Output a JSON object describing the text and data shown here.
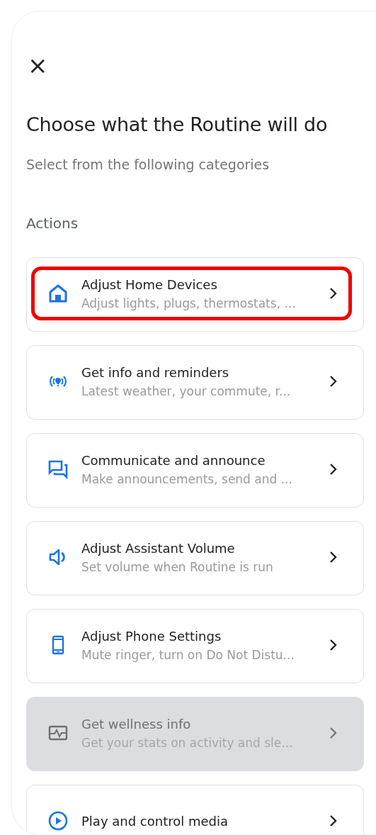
{
  "close_button": "×",
  "title": "Choose what the Routine will do",
  "subtitle": "Select from the following categories",
  "section_label": "Actions",
  "actions": [
    {
      "title": "Adjust Home Devices",
      "description": "Adjust lights, plugs, thermostats, ...",
      "highlighted": true,
      "disabled": false
    },
    {
      "title": "Get info and reminders",
      "description": "Latest weather, your commute, r...",
      "highlighted": false,
      "disabled": false
    },
    {
      "title": "Communicate and announce",
      "description": "Make announcements, send and ...",
      "highlighted": false,
      "disabled": false
    },
    {
      "title": "Adjust Assistant Volume",
      "description": "Set volume when Routine is run",
      "highlighted": false,
      "disabled": false
    },
    {
      "title": "Adjust Phone Settings",
      "description": "Mute ringer, turn on Do Not Distu...",
      "highlighted": false,
      "disabled": false
    },
    {
      "title": "Get wellness info",
      "description": "Get your stats on activity and sle...",
      "highlighted": false,
      "disabled": true
    },
    {
      "title": "Play and control media",
      "highlighted": false,
      "disabled": false
    }
  ]
}
